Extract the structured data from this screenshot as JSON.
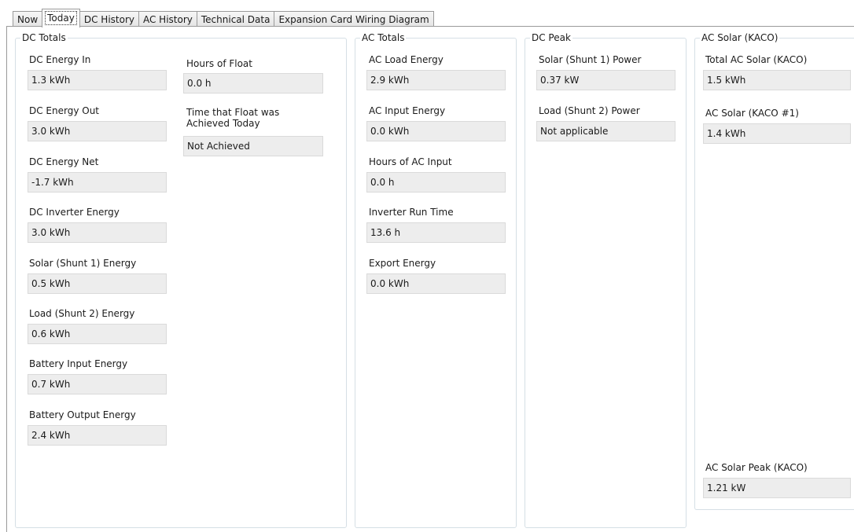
{
  "tabs": [
    "Now",
    "Today",
    "DC History",
    "AC History",
    "Technical Data",
    "Expansion Card Wiring Diagram"
  ],
  "active_tab": "Today",
  "dc_totals": {
    "title": "DC Totals",
    "fields": [
      {
        "label": "DC Energy In",
        "value": "1.3 kWh"
      },
      {
        "label": "DC Energy Out",
        "value": "3.0 kWh"
      },
      {
        "label": "DC Energy Net",
        "value": "-1.7 kWh"
      },
      {
        "label": "DC Inverter Energy",
        "value": "3.0 kWh"
      },
      {
        "label": "Solar (Shunt 1) Energy",
        "value": "0.5 kWh"
      },
      {
        "label": "Load (Shunt 2) Energy",
        "value": "0.6 kWh"
      },
      {
        "label": "Battery Input Energy",
        "value": "0.7 kWh"
      },
      {
        "label": "Battery Output Energy",
        "value": "2.4 kWh"
      }
    ],
    "float": {
      "hours_label": "Hours of Float",
      "hours_value": "0.0 h",
      "time_label_line1": "Time that Float was",
      "time_label_line2": "Achieved Today",
      "time_value": "Not Achieved"
    }
  },
  "ac_totals": {
    "title": "AC Totals",
    "fields": [
      {
        "label": "AC Load Energy",
        "value": "2.9 kWh"
      },
      {
        "label": "AC Input Energy",
        "value": "0.0 kWh"
      },
      {
        "label": "Hours of AC Input",
        "value": "0.0 h"
      },
      {
        "label": "Inverter Run Time",
        "value": "13.6 h"
      },
      {
        "label": "Export Energy",
        "value": "0.0 kWh"
      }
    ]
  },
  "dc_peak": {
    "title": "DC Peak",
    "fields": [
      {
        "label": "Solar (Shunt 1) Power",
        "value": "0.37 kW"
      },
      {
        "label": "Load (Shunt 2) Power",
        "value": "Not applicable"
      }
    ]
  },
  "ac_solar": {
    "title": "AC Solar (KACO)",
    "fields": [
      {
        "label": "Total AC Solar (KACO)",
        "value": "1.5 kWh"
      },
      {
        "label": "AC Solar (KACO #1)",
        "value": "1.4 kWh"
      }
    ],
    "peak_label": "AC Solar Peak (KACO)",
    "peak_value": "1.21 kW"
  }
}
